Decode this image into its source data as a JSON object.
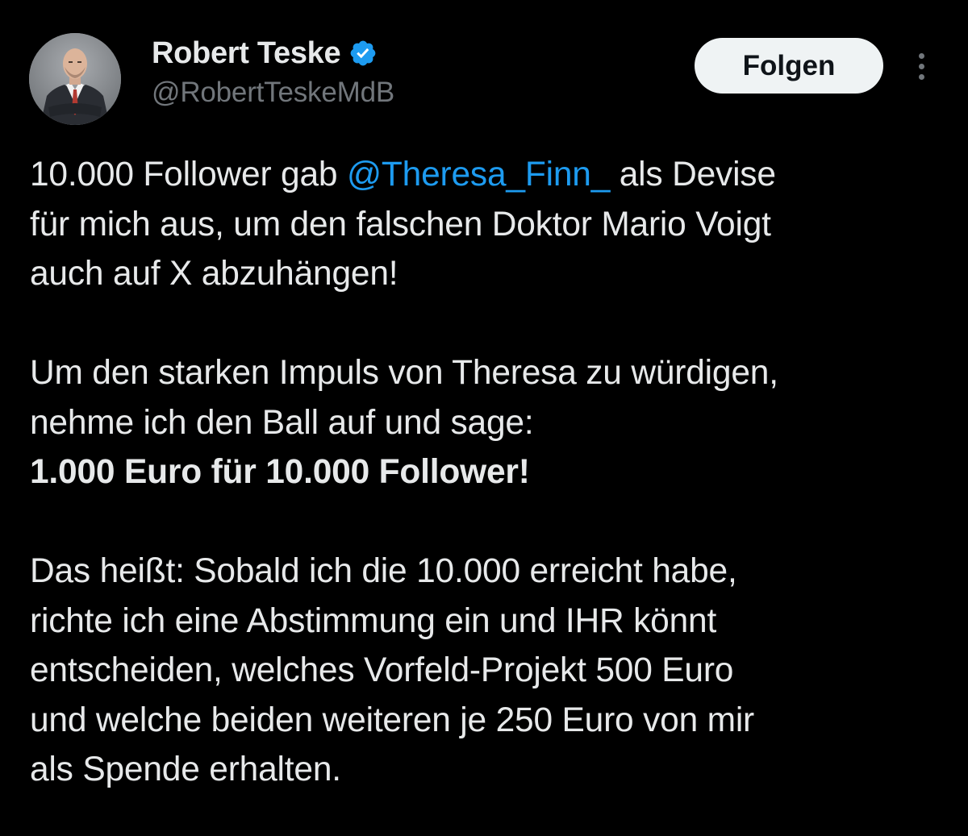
{
  "author": {
    "display_name": "Robert Teske",
    "handle": "@RobertTeskeMdB",
    "verified": true,
    "verified_color": "#1d9bf0"
  },
  "actions": {
    "follow_label": "Folgen",
    "more_icon": "more-vertical-icon"
  },
  "tweet": {
    "para1": {
      "before_mention": "10.000 Follower gab ",
      "mention": "@Theresa_Finn_",
      "after_mention_line1": " als Devise",
      "line2": "für mich aus, um den falschen Doktor Mario Voigt",
      "line3": "auch auf X abzuhängen!"
    },
    "para2": {
      "line1": "Um den starken Impuls von Theresa zu würdigen,",
      "line2": "nehme ich den Ball auf und sage:",
      "line3_bold": "1.000 Euro für 10.000 Follower!"
    },
    "para3": {
      "line1": "Das heißt: Sobald ich die 10.000 erreicht habe,",
      "line2": "richte ich eine Abstimmung ein und IHR könnt",
      "line3": "entscheiden, welches Vorfeld-Projekt 500 Euro",
      "line4": "und welche beiden weiteren je 250 Euro von mir",
      "line5": "als Spende erhalten."
    }
  },
  "colors": {
    "background": "#000000",
    "text": "#e7e9ea",
    "secondary": "#71767b",
    "link": "#1d9bf0",
    "button_bg": "#eff3f4"
  }
}
